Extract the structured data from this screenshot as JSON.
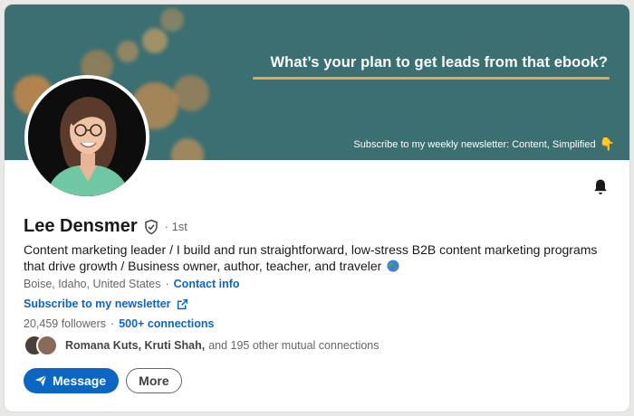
{
  "banner": {
    "headline": "What’s your plan to get leads from that ebook?",
    "subtext": "Subscribe to my weekly newsletter: Content, Simplified",
    "hand_emoji": "👇"
  },
  "profile": {
    "name": "Lee Densmer",
    "degree": "· 1st",
    "headline": "Content marketing leader / I build and run straightforward, low-stress B2B content marketing programs that drive growth / Business owner, author, teacher, and traveler",
    "location": "Boise, Idaho, United States",
    "contact_info": "Contact info",
    "newsletter_link": "Subscribe to my newsletter",
    "followers": "20,459 followers",
    "connections": "500+ connections",
    "mutual_names": "Romana Kuts, Kruti Shah,",
    "mutual_rest": "and 195 other mutual connections"
  },
  "actions": {
    "message": "Message",
    "more": "More"
  },
  "colors": {
    "banner": "#3c6f72",
    "accent": "#e8a74f",
    "link": "#0a66c2"
  },
  "icons": [
    "bell-icon",
    "verified-shield-icon",
    "globe-icon",
    "external-link-icon",
    "send-icon"
  ]
}
